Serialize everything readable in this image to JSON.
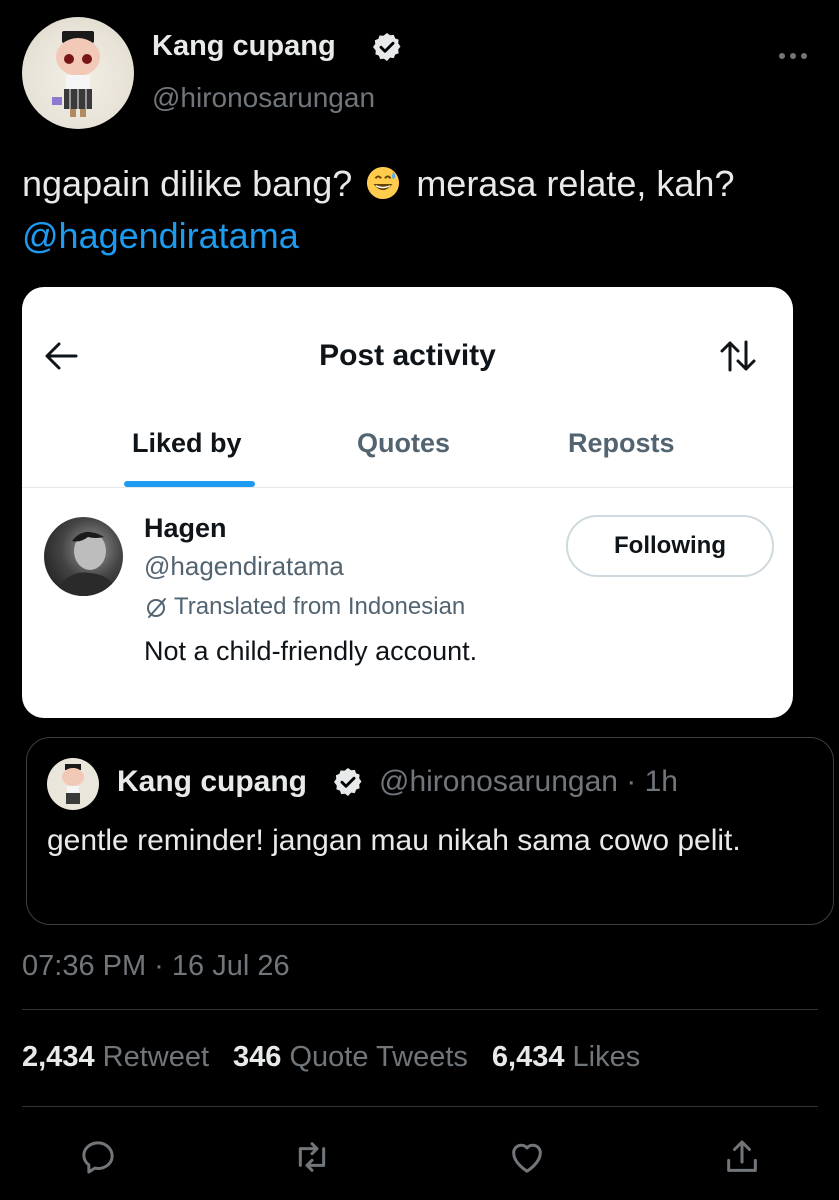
{
  "author": {
    "name": "Kang cupang",
    "handle": "@hironosarungan"
  },
  "tweet": {
    "text_part1": "ngapain dilike bang?",
    "text_part2": "merasa relate, kah?",
    "mention": "@hagendiratama",
    "emoji_icon": "grinning-sweat-emoji-icon"
  },
  "screenshot_card": {
    "title": "Post activity",
    "tabs": [
      {
        "label": "Liked by",
        "active": true
      },
      {
        "label": "Quotes",
        "active": false
      },
      {
        "label": "Reposts",
        "active": false
      }
    ],
    "user": {
      "name": "Hagen",
      "handle": "@hagendiratama",
      "translated_note": "Translated from Indonesian",
      "bio": "Not a child-friendly account.",
      "follow_label": "Following"
    }
  },
  "quoted_tweet": {
    "name": "Kang cupang",
    "handle_time": "@hironosarungan · 1h",
    "text": "gentle reminder! jangan mau nikah sama cowo pelit."
  },
  "timestamp": "07:36 PM · 16 Jul 26",
  "stats": {
    "retweets_count": "2,434",
    "retweets_label": "Retweet",
    "quotes_count": "346",
    "quotes_label": "Quote Tweets",
    "likes_count": "6,434",
    "likes_label": "Likes"
  },
  "colors": {
    "background": "#000000",
    "link": "#1d9bf0",
    "muted": "#71767b",
    "verified": "#e7e9ea"
  }
}
